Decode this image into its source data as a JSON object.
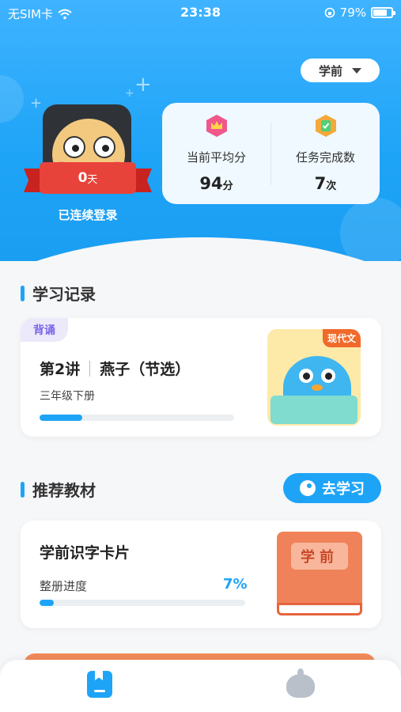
{
  "status_bar": {
    "carrier": "无SIM卡",
    "time": "23:38",
    "battery": "79%",
    "battery_level": 0.79
  },
  "header": {
    "grade_selector": "学前",
    "avatar": {
      "streak_value": "0",
      "streak_unit": "天",
      "label": "已连续登录"
    },
    "stats": [
      {
        "label": "当前平均分",
        "value": "94",
        "unit": "分",
        "icon": "crown-badge-icon",
        "color": "#f0578a"
      },
      {
        "label": "任务完成数",
        "value": "7",
        "unit": "次",
        "icon": "check-badge-icon",
        "color": "#f4a93b"
      }
    ]
  },
  "study_record": {
    "title": "学习记录",
    "card": {
      "tag": "背诵",
      "lesson": "第2讲",
      "name": "燕子（节选）",
      "grade": "三年级下册",
      "progress": 0.22,
      "thumb_tag": "现代文"
    }
  },
  "recommended": {
    "title": "推荐教材",
    "button": "去学习",
    "card": {
      "name": "学前识字卡片",
      "progress_label": "整册进度",
      "progress_text": "7%",
      "progress": 0.07,
      "cover_text": "学前"
    }
  },
  "bottom_nav": [
    {
      "name": "study-tab",
      "icon": "book-icon",
      "active": true
    },
    {
      "name": "profile-tab",
      "icon": "mascot-icon",
      "active": false
    }
  ],
  "colors": {
    "primary": "#1ea4f7",
    "ribbon": "#e8433a",
    "tag_purple": "#7b63e6"
  }
}
